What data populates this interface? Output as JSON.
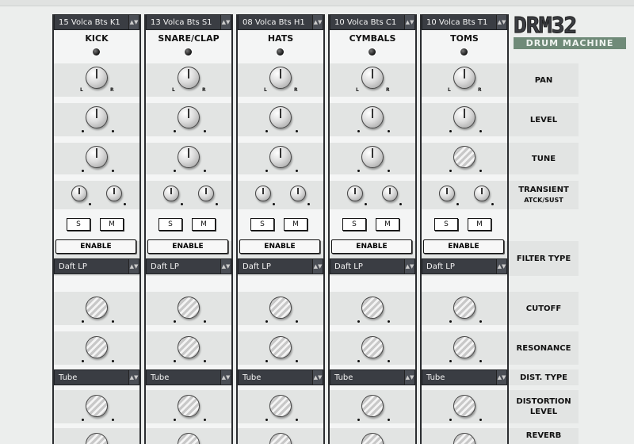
{
  "logo": {
    "title": "DRM32",
    "subtitle": "DRUM MACHINE"
  },
  "channels": [
    {
      "sample": "15 Volca Bts K1",
      "name": "KICK",
      "filter_type": "Daft LP",
      "dist_type": "Tube"
    },
    {
      "sample": "13 Volca Bts S1",
      "name": "SNARE/CLAP",
      "filter_type": "Daft LP",
      "dist_type": "Tube"
    },
    {
      "sample": "08 Volca Bts H1",
      "name": "HATS",
      "filter_type": "Daft LP",
      "dist_type": "Tube"
    },
    {
      "sample": "10 Volca Bts C1",
      "name": "CYMBALS",
      "filter_type": "Daft LP",
      "dist_type": "Tube"
    },
    {
      "sample": "10 Volca Bts T1",
      "name": "TOMS",
      "filter_type": "Daft LP",
      "dist_type": "Tube"
    }
  ],
  "labels": {
    "pan": "PAN",
    "level": "LEVEL",
    "tune": "TUNE",
    "transient": "TRANSIENT",
    "transient_sub": "ATCK/SUST",
    "filter_type": "FILTER TYPE",
    "cutoff": "CUTOFF",
    "resonance": "RESONANCE",
    "dist_type": "DIST. TYPE",
    "dist_level_1": "DISTORTION",
    "dist_level_2": "LEVEL",
    "reverb": "REVERB"
  },
  "buttons": {
    "solo": "S",
    "mute": "M",
    "enable": "ENABLE"
  },
  "pan_marks": {
    "left": "L",
    "right": "R"
  },
  "dropdown_arrow": "▲▼"
}
